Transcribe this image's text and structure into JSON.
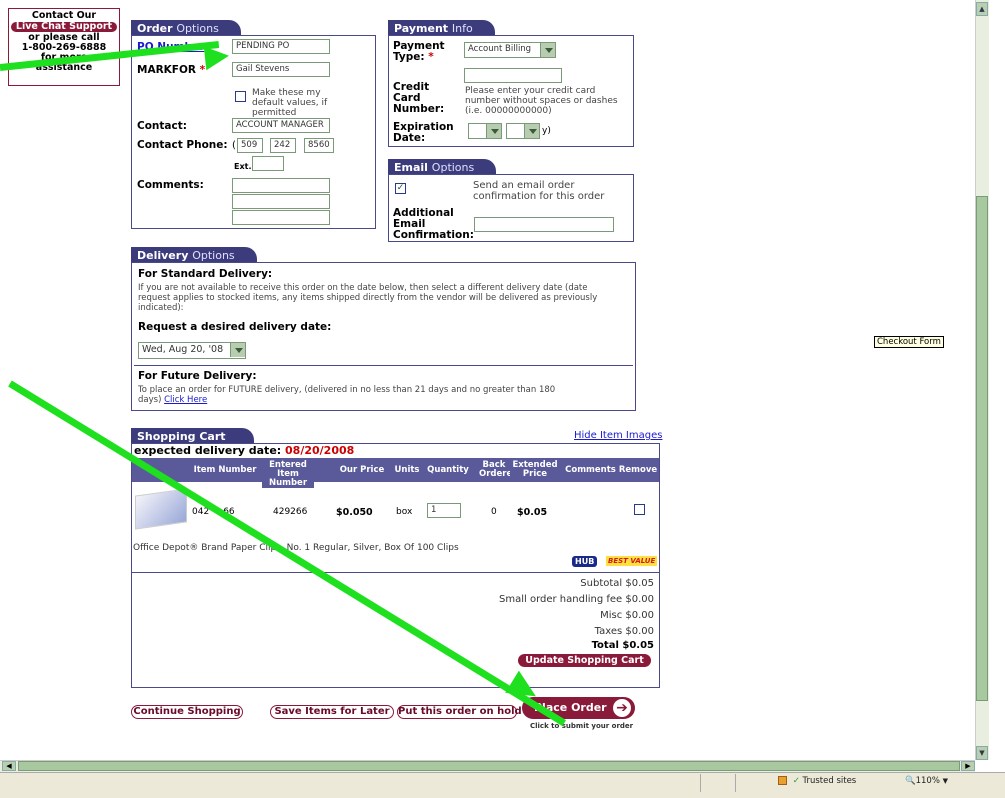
{
  "support": {
    "line1": "Contact Our",
    "badge": "Live Chat Support",
    "line2": "or please call",
    "phone": "1-800-269-6888",
    "line3": "for more",
    "line4": "assistance"
  },
  "order_options": {
    "tab_bold": "Order",
    "tab_light": "Options",
    "po_label": "PO Number",
    "po_value": "PENDING PO",
    "markfor_label": "MARKFOR",
    "markfor_value": "Gail Stevens",
    "default_label": "Make these my default values, if permitted",
    "contact_label": "Contact:",
    "contact_value": "ACCOUNT MANAGER",
    "phone_label": "Contact Phone:",
    "phone_area": "509",
    "phone_prefix": "242",
    "phone_line": "8560",
    "ext_label": "Ext.",
    "comments_label": "Comments:"
  },
  "payment": {
    "tab_bold": "Payment",
    "tab_light": "Info",
    "type_label": "Payment Type:",
    "type_value": "Account Billing",
    "cc_label": "Credit Card Number:",
    "cc_help": "Please enter your credit card number without spaces or dashes (i.e. 00000000000)",
    "exp_label": "Expiration Date:",
    "exp_suffix": "y)"
  },
  "email": {
    "tab_bold": "Email",
    "tab_light": "Options",
    "send_label": "Send an email order confirmation for this order",
    "additional_label": "Additional Email Confirmation:"
  },
  "delivery": {
    "tab_bold": "Delivery",
    "tab_light": "Options",
    "std_heading": "For Standard Delivery:",
    "std_text": "If you are not available to receive this order on the date below, then select a different delivery date (date request applies to stocked items, any items shipped directly from the vendor will be delivered as previously indicated):",
    "request_heading": "Request a desired delivery date:",
    "date_value": "Wed, Aug 20, '08",
    "future_heading": "For Future Delivery:",
    "future_text": "To place an order for FUTURE delivery, (delivered in no less than 21 days and no greater than 180 days)",
    "click_here": "Click Here"
  },
  "cart": {
    "tab": "Shopping Cart",
    "hide_images": "Hide Item Images",
    "expected_label": "expected delivery date:",
    "expected_date": "08/20/2008",
    "columns": [
      "Item Number",
      "Entered Item Number",
      "Our Price",
      "Units",
      "Quantity",
      "Back Ordered",
      "Extended Price",
      "Comments",
      "Remove"
    ],
    "item": {
      "number": "042",
      "suffix": "66",
      "entered": "429266",
      "price": "$0.050",
      "units": "box",
      "quantity": "1",
      "back_ordered": "0",
      "extended": "$0.05",
      "description": "Office Depot® Brand Paper Clips, No. 1 Regular, Silver, Box Of 100 Clips"
    },
    "badge_hub": "HUB",
    "badge_best": "BEST VALUE",
    "subtotal": "Subtotal $0.05",
    "handling": "Small order handling fee  $0.00",
    "misc": "Misc $0.00",
    "taxes": "Taxes $0.00",
    "total": "Total  $0.05",
    "update": "Update Shopping Cart"
  },
  "actions": {
    "continue": "Continue Shopping",
    "save": "Save Items for Later",
    "hold": "Put this order on hold",
    "place": "Place Order",
    "place_sub": "Click to submit your order"
  },
  "tooltip": "Checkout Form",
  "statusbar": {
    "zone": "Trusted sites",
    "zoom": "110%"
  },
  "colors": {
    "navy": "#3c3c7c",
    "maroon": "#8a1a3a",
    "arrow_green": "#1ee01e"
  }
}
